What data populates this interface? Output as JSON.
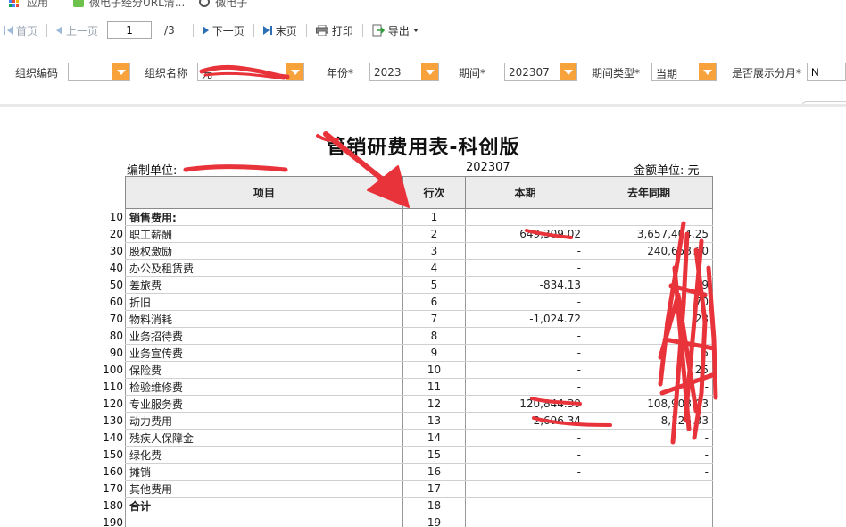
{
  "bookmarks": [
    {
      "label": "应用",
      "icon": "apps-grid-icon"
    },
    {
      "label": "微电子经分URL清...",
      "icon": "bookmark-green-icon"
    },
    {
      "label": "微电子",
      "icon": "bookmark-circle-icon"
    }
  ],
  "toolbar": {
    "first_label": "首页",
    "prev_label": "上一页",
    "page_value": "1",
    "page_total": "/3",
    "next_label": "下一页",
    "last_label": "末页",
    "print_label": "打印",
    "export_label": "导出"
  },
  "filters": {
    "org_code_label": "组织编码",
    "org_code_value": "",
    "org_name_label": "组织名称",
    "org_name_value": "元",
    "year_label": "年份*",
    "year_value": "2023",
    "period_label": "期间*",
    "period_value": "202307",
    "period_type_label": "期间类型*",
    "period_type_value": "当期",
    "show_month_label": "是否展示分月*",
    "show_month_value": "N"
  },
  "report": {
    "title": "管销研费用表-科创版",
    "unit_label": "编制单位:",
    "period": "202307",
    "currency_label": "金额单位: 元",
    "headers": {
      "item": "项目",
      "line": "行次",
      "current": "本期",
      "last_year": "去年同期"
    },
    "rows": [
      {
        "code": "10",
        "item": "销售费用:",
        "line": "1",
        "current": "",
        "last_year": "",
        "bold": true
      },
      {
        "code": "20",
        "item": "职工薪酬",
        "line": "2",
        "current": "649,309.02",
        "last_year": "3,657,404.25"
      },
      {
        "code": "30",
        "item": "股权激励",
        "line": "3",
        "current": "-",
        "last_year": "240,658.60"
      },
      {
        "code": "40",
        "item": "办公及租赁费",
        "line": "4",
        "current": "-",
        "last_year": ""
      },
      {
        "code": "50",
        "item": "差旅费",
        "line": "5",
        "current": "-834.13",
        "last_year": "79"
      },
      {
        "code": "60",
        "item": "折旧",
        "line": "6",
        "current": "-",
        "last_year": "70"
      },
      {
        "code": "70",
        "item": "物料消耗",
        "line": "7",
        "current": "-1,024.72",
        "last_year": "23"
      },
      {
        "code": "80",
        "item": "业务招待费",
        "line": "8",
        "current": "-",
        "last_year": ""
      },
      {
        "code": "90",
        "item": "业务宣传费",
        "line": "9",
        "current": "-",
        "last_year": "5"
      },
      {
        "code": "100",
        "item": "保险费",
        "line": "10",
        "current": "-",
        "last_year": "25"
      },
      {
        "code": "110",
        "item": "检验维修费",
        "line": "11",
        "current": "-",
        "last_year": "-"
      },
      {
        "code": "120",
        "item": "专业服务费",
        "line": "12",
        "current": "120,844.39",
        "last_year": "108,908.03"
      },
      {
        "code": "130",
        "item": "动力费用",
        "line": "13",
        "current": "2,696.34",
        "last_year": "8,126.33"
      },
      {
        "code": "140",
        "item": "残疾人保障金",
        "line": "14",
        "current": "-",
        "last_year": "-"
      },
      {
        "code": "150",
        "item": "绿化费",
        "line": "15",
        "current": "-",
        "last_year": "-"
      },
      {
        "code": "160",
        "item": "摊销",
        "line": "16",
        "current": "-",
        "last_year": "-"
      },
      {
        "code": "170",
        "item": "其他费用",
        "line": "17",
        "current": "-",
        "last_year": "-"
      },
      {
        "code": "180",
        "item": "合计",
        "line": "18",
        "current": "-",
        "last_year": "-",
        "bold": true
      },
      {
        "code": "190",
        "item": "",
        "line": "19",
        "current": "",
        "last_year": ""
      }
    ]
  },
  "colors": {
    "accent_orange": "#f7a23a",
    "nav_blue": "#2c6fb4",
    "annotation_red": "#e8333a"
  }
}
